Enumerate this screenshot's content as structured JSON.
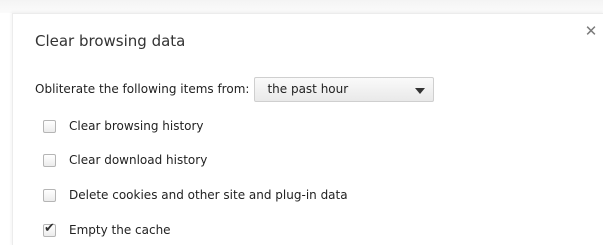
{
  "dialog": {
    "title": "Clear browsing data",
    "close_icon": "close-icon"
  },
  "time_range": {
    "label": "Obliterate the following items from:",
    "selected": "the past hour"
  },
  "options": [
    {
      "label": "Clear browsing history",
      "checked": false
    },
    {
      "label": "Clear download history",
      "checked": false
    },
    {
      "label": "Delete cookies and other site and plug-in data",
      "checked": false
    },
    {
      "label": "Empty the cache",
      "checked": true
    }
  ]
}
